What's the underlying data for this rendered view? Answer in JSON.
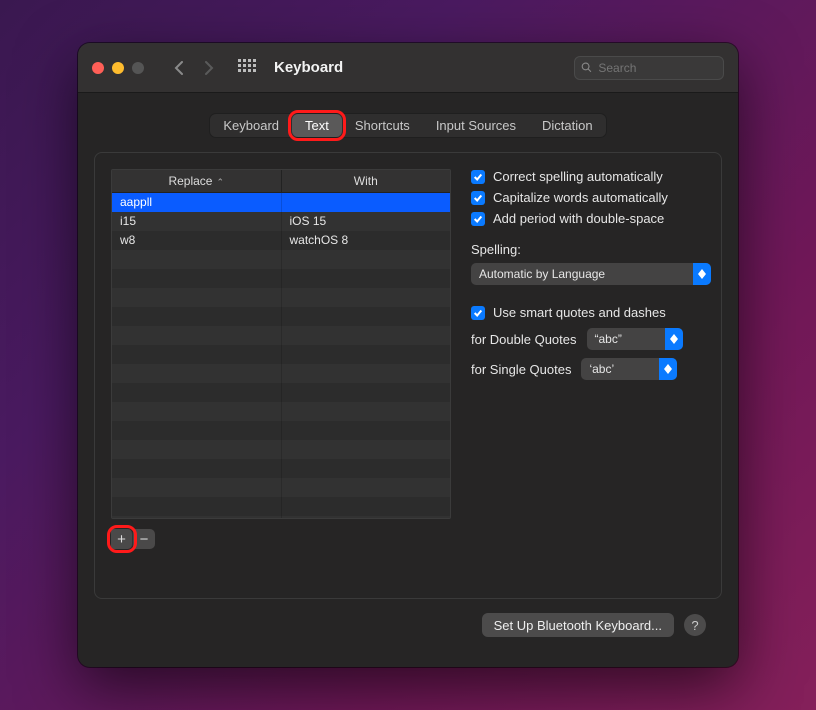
{
  "window": {
    "title": "Keyboard"
  },
  "search": {
    "placeholder": "Search"
  },
  "tabs": [
    "Keyboard",
    "Text",
    "Shortcuts",
    "Input Sources",
    "Dictation"
  ],
  "active_tab_index": 1,
  "table": {
    "headers": {
      "replace": "Replace",
      "with": "With"
    },
    "rows": [
      {
        "replace": "aappll",
        "with": "",
        "selected": true
      },
      {
        "replace": "i15",
        "with": "iOS 15",
        "selected": false
      },
      {
        "replace": "w8",
        "with": "watchOS 8",
        "selected": false
      }
    ]
  },
  "options": {
    "correct_spelling": "Correct spelling automatically",
    "capitalize": "Capitalize words automatically",
    "double_space": "Add period with double-space",
    "spelling_label": "Spelling:",
    "spelling_value": "Automatic by Language",
    "smart_quotes": "Use smart quotes and dashes",
    "double_quotes_label": "for Double Quotes",
    "double_quotes_value": "“abc”",
    "single_quotes_label": "for Single Quotes",
    "single_quotes_value": "‘abc’"
  },
  "footer": {
    "bluetooth": "Set Up Bluetooth Keyboard..."
  }
}
